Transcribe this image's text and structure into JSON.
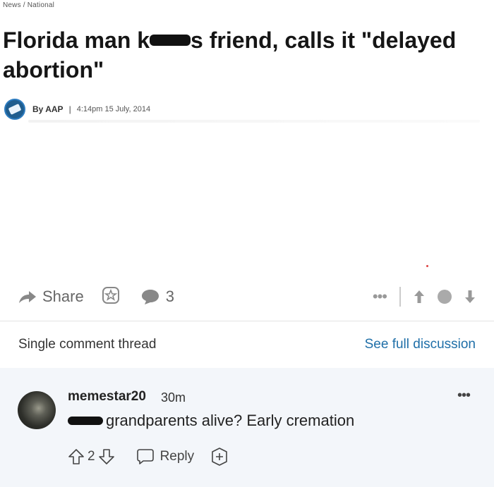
{
  "article": {
    "breadcrumb": "News / National",
    "headline_part1": "Florida man k",
    "headline_part2": "s friend, calls it \"delayed abortion\"",
    "byline_author": "By AAP",
    "byline_separator": "|",
    "byline_date": "4:14pm 15 July, 2014"
  },
  "actions": {
    "share_label": "Share",
    "comment_count": "3",
    "more_dots": "•••"
  },
  "thread": {
    "label": "Single comment thread",
    "link": "See full discussion"
  },
  "comment": {
    "username": "memestar20",
    "time": "30m",
    "more_dots": "•••",
    "text": "grandparents alive? Early cremation",
    "vote_count": "2",
    "reply_label": "Reply"
  },
  "colors": {
    "link": "#1f6fa8",
    "comment_bg": "#f3f6fa",
    "logo": "#1f5d8e"
  },
  "icons": [
    "share-arrow-icon",
    "star-icon",
    "comment-bubble-icon",
    "upvote-icon",
    "downvote-icon",
    "reply-bubble-icon",
    "plus-circle-icon"
  ]
}
